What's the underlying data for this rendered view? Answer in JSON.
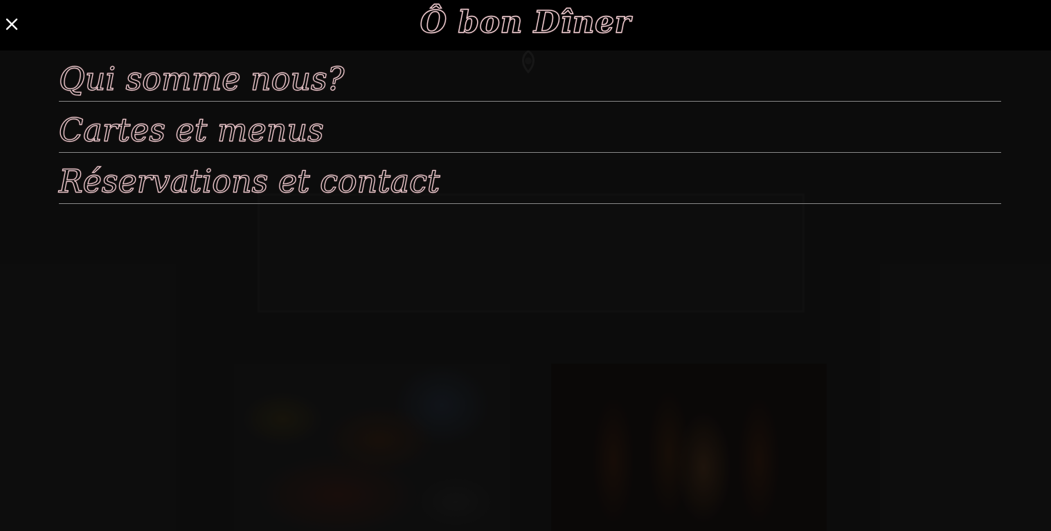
{
  "header": {
    "brand": "Ô bon Dîner",
    "close_icon": "close-icon"
  },
  "menu": {
    "items": [
      {
        "label": "Qui somme nous?"
      },
      {
        "label": "Cartes et menus"
      },
      {
        "label": "Réservations et contact"
      }
    ]
  },
  "background": {
    "ornament_icon": "decorative-ornament-icon"
  },
  "colors": {
    "topbar": "#000000",
    "accent_outline": "#f6d2d6",
    "divider": "#8a8a8a",
    "page_bg": "#121212"
  }
}
